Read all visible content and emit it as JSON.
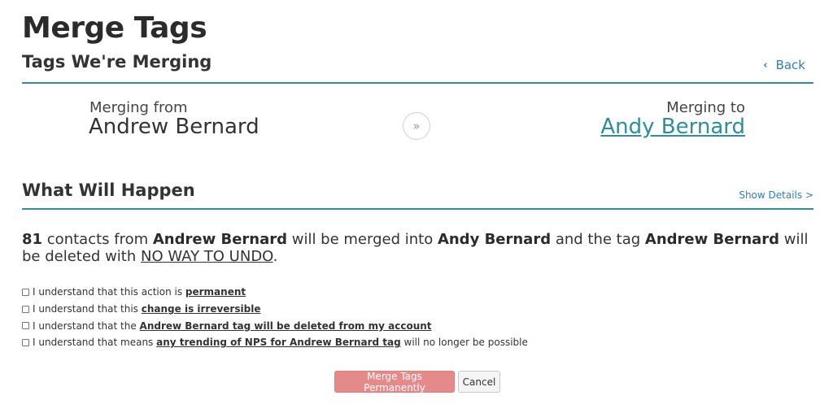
{
  "page": {
    "title": "Merge Tags"
  },
  "colors": {
    "accent": "#2e8f99",
    "link": "#2f7fb6",
    "danger_button": "#e48a8a"
  },
  "tags_section": {
    "title": "Tags We're Merging",
    "back_label": "Back",
    "back_icon": "chevron-left-icon"
  },
  "merge": {
    "from_label": "Merging from",
    "from_name": "Andrew Bernard",
    "arrow_icon": "double-chevron-right-icon",
    "arrow_glyph": "»",
    "to_label": "Merging to",
    "to_name": "Andy Bernard"
  },
  "what_section": {
    "title": "What Will Happen",
    "show_details": "Show Details >"
  },
  "summary": {
    "count": "81",
    "t1": " contacts from ",
    "from_tag": "Andrew Bernard",
    "t2": " will be merged into ",
    "to_tag": "Andy Bernard",
    "t3": " and the tag ",
    "deleted_tag": "Andrew Bernard",
    "t4": " will be deleted with ",
    "warning": "NO WAY TO UNDO",
    "t5": "."
  },
  "acknowledgements": [
    {
      "prefix": "I understand that this action is ",
      "emphasis": "permanent",
      "suffix": ""
    },
    {
      "prefix": "I understand that this ",
      "emphasis": "change is irreversible",
      "suffix": ""
    },
    {
      "prefix": "I understand that the ",
      "emphasis": "Andrew Bernard tag will be deleted from my account",
      "suffix": ""
    },
    {
      "prefix": "I understand that means ",
      "emphasis": "any trending of NPS for Andrew Bernard tag",
      "suffix": " will no longer be possible"
    }
  ],
  "actions": {
    "merge_label": "Merge Tags Permanently",
    "cancel_label": "Cancel"
  }
}
